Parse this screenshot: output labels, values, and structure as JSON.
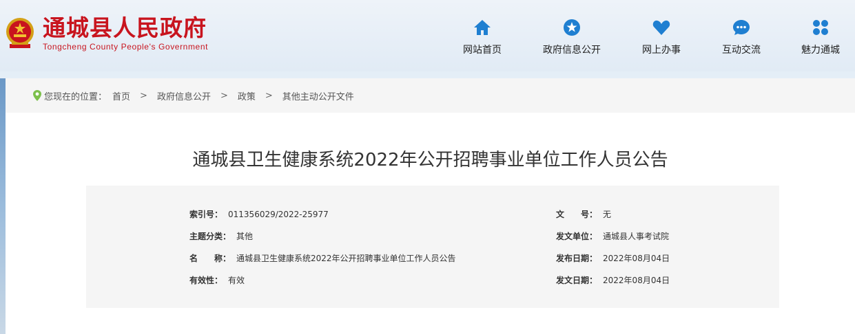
{
  "header": {
    "logo_cn": "通城县人民政府",
    "logo_en": "Tongcheng County People's Government",
    "nav": [
      {
        "label": "网站首页",
        "icon": "home-icon"
      },
      {
        "label": "政府信息公开",
        "icon": "star-icon"
      },
      {
        "label": "网上办事",
        "icon": "heart-icon"
      },
      {
        "label": "互动交流",
        "icon": "chat-icon"
      },
      {
        "label": "魅力通城",
        "icon": "grid-icon"
      }
    ]
  },
  "breadcrumb": {
    "prefix": "您现在的位置：",
    "items": [
      "首页",
      "政府信息公开",
      "政策",
      "其他主动公开文件"
    ],
    "separator": ">"
  },
  "article": {
    "title": "通城县卫生健康系统2022年公开招聘事业单位工作人员公告"
  },
  "meta": {
    "index_label": "索引号：",
    "index_value": "011356029/2022-25977",
    "topic_label": "主题分类：",
    "topic_value": "其他",
    "name_label": "名　　称：",
    "name_value": "通城县卫生健康系统2022年公开招聘事业单位工作人员公告",
    "validity_label": "有效性：",
    "validity_value": "有效",
    "doc_no_label": "文　　号：",
    "doc_no_value": "无",
    "issuer_label": "发文单位：",
    "issuer_value": "通城县人事考试院",
    "publish_label": "发布日期：",
    "publish_value": "2022年08月04日",
    "doc_date_label": "发文日期：",
    "doc_date_value": "2022年08月04日"
  },
  "colors": {
    "brand_red": "#c8141e",
    "nav_icon_blue": "#1f7fd1",
    "pin_green": "#7cc04b"
  }
}
